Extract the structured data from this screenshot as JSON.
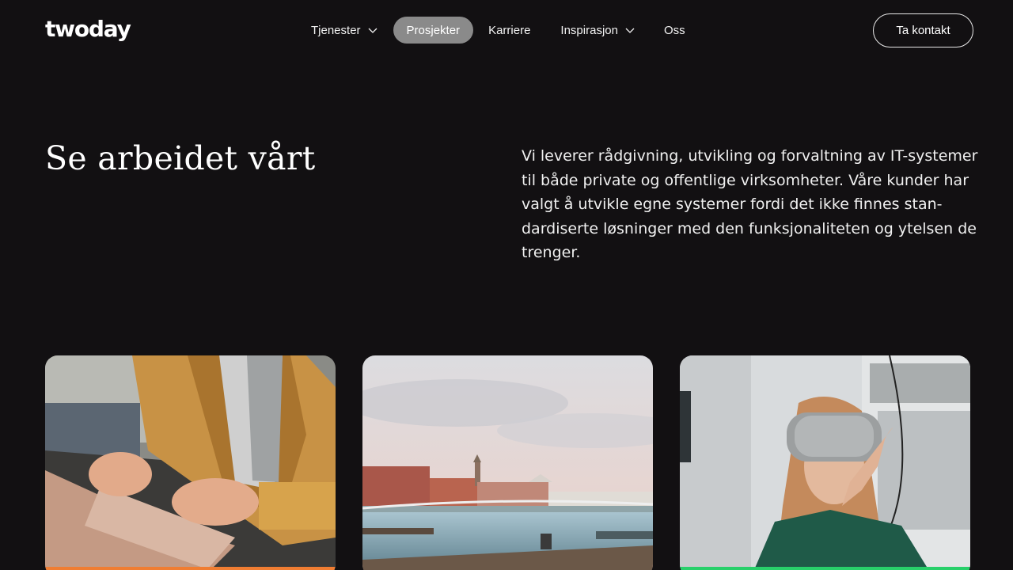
{
  "header": {
    "logo": "twoday",
    "nav": [
      {
        "label": "Tjenester",
        "dropdown": true,
        "active": false
      },
      {
        "label": "Prosjekter",
        "dropdown": false,
        "active": true
      },
      {
        "label": "Karriere",
        "dropdown": false,
        "active": false
      },
      {
        "label": "Inspirasjon",
        "dropdown": true,
        "active": false
      },
      {
        "label": "Oss",
        "dropdown": false,
        "active": false
      }
    ],
    "cta_label": "Ta kontakt"
  },
  "hero": {
    "title": "Se arbeidet vårt",
    "description": "Vi leverer rådgivning, utvikling og forvaltning av IT-systemer til både private og offentlige virksomheter. Våre kunder har valgt å utvikle egne systemer fordi det ikke finnes stan­dardiserte løsninger med den funksjonaliteten og ytelsen de trenger."
  },
  "cards": [
    {
      "image": "laptop-typing-image",
      "accent": "#f07d32"
    },
    {
      "image": "harbor-city-image",
      "accent": ""
    },
    {
      "image": "vr-headset-image",
      "accent": "#28d06a"
    }
  ],
  "colors": {
    "background": "#121012",
    "active_nav": "#8a8a8a",
    "text": "#f2f2f2"
  }
}
